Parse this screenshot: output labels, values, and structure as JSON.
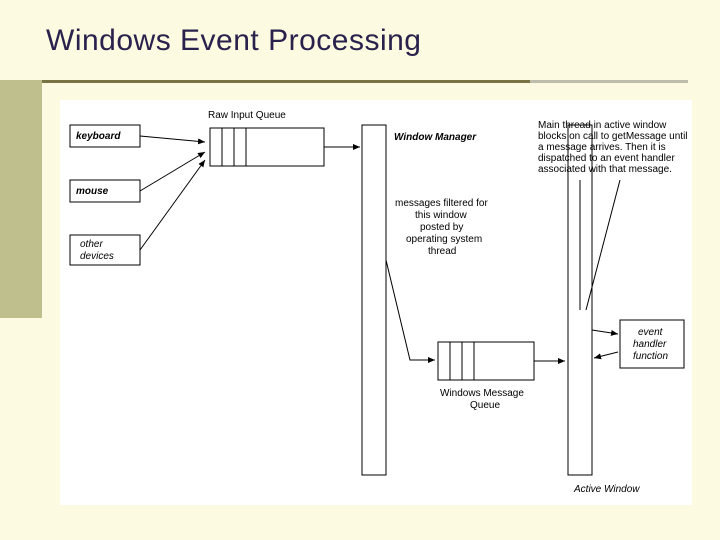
{
  "title": "Windows Event Processing",
  "boxes": {
    "keyboard": "keyboard",
    "mouse": "mouse",
    "other": "other\ndevices",
    "rawQueue": "Raw Input Queue",
    "winMgr": "Window Manager",
    "msgFilter": "messages filtered for\nthis window\nposted by\noperating system\nthread",
    "winMsgQ": "Windows Message\nQueue",
    "eventHandler": "event\nhandler\nfunction",
    "activeWindow": "Active Window",
    "note": "Main thread in active window\nblocks on call to getMessage until\na message arrives. Then it is\ndispatched to an event handler\nassociated with that message."
  }
}
